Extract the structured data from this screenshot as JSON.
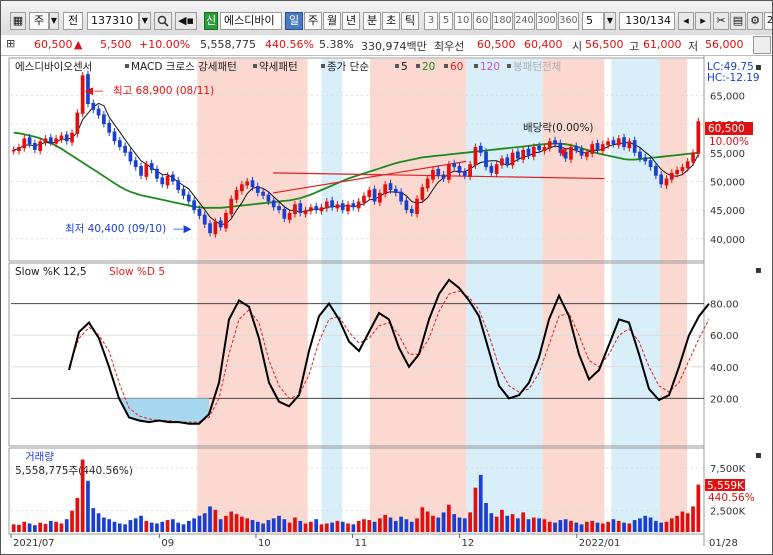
{
  "toolbar": {
    "code_type": "주",
    "period_type": "전",
    "stock_code": "137310",
    "new_badge": "신",
    "stock_name": "에스디바이",
    "period_buttons": [
      "일",
      "주",
      "월",
      "년",
      "분",
      "초",
      "틱"
    ],
    "minute_buttons": [
      "3",
      "5",
      "10",
      "60",
      "180",
      "240",
      "300",
      "360"
    ],
    "unit_value": "5",
    "count_display": "130",
    "count_total": "/134"
  },
  "quote": {
    "price": "60,500",
    "change": "5,500",
    "change_pct": "+10.00%",
    "volume": "5,558,775",
    "volume_ratio": "440.56%",
    "turnover": "5.38%",
    "amount": "330,974백만",
    "priority_label": "최우선",
    "ask": "60,500",
    "bid": "60,400",
    "open_label": "시",
    "open": "56,500",
    "high_label": "고",
    "high": "61,000",
    "low_label": "저",
    "low": "56,000"
  },
  "panes": {
    "price_title": "에스디바이오센서",
    "price_indicators": [
      {
        "label": "MACD 크로스 강세패턴",
        "color": "#222222"
      },
      {
        "label": "약세패턴",
        "color": "#222222"
      },
      {
        "label": "종가 단순",
        "color": "#222222"
      },
      {
        "label": "5",
        "color": "#111111"
      },
      {
        "label": "20",
        "color": "#1e8a1e"
      },
      {
        "label": "60",
        "color": "#e02020"
      },
      {
        "label": "120",
        "color": "#d04fd0"
      },
      {
        "label": "봉패턴전체",
        "color": "#b0b0b0"
      }
    ],
    "lc_label": "LC:49.75",
    "hc_label": "HC:-12.19",
    "high_marker": "최고 68,900 (08/11)",
    "low_marker": "최저 40,400 (09/10)",
    "dividend_marker": "배당락(0.00%)",
    "price_tag": "60,500",
    "pct_tag": "10.00%",
    "price_axis": [
      "65,000",
      "60,000",
      "55,000",
      "50,000",
      "45,000",
      "40,000"
    ],
    "stoch_title": "Slow %K 12,5",
    "stoch_title2": "Slow %D 5",
    "stoch_axis": [
      "80.00",
      "60.00",
      "40.00",
      "20.00"
    ],
    "volume_title": "거래량",
    "volume_value": "5,558,775주(440.56%)",
    "volume_axis": [
      "7,500K",
      "2,500K"
    ],
    "volume_tag": "5,559K",
    "volume_pct_tag": "440.56%",
    "date_axis": [
      "2021/07",
      "09",
      "10",
      "11",
      "12",
      "2022/01",
      "01/28"
    ]
  },
  "colors": {
    "up": "#e01010",
    "down": "#1a3fd0",
    "ma5": "#111111",
    "ma20": "#1e8a1e",
    "ma60": "#e02020",
    "ma120": "#d04fd0",
    "bull_band": "#fbd9d0",
    "bear_band": "#d8eef9"
  },
  "chart_data": {
    "type": "candlestick",
    "price_ylim": [
      37000,
      71000
    ],
    "candles_close": [
      55500,
      56000,
      57500,
      56500,
      55500,
      57000,
      57500,
      56800,
      57500,
      58000,
      57000,
      58500,
      62000,
      68500,
      63500,
      62500,
      61500,
      60000,
      58500,
      57000,
      56000,
      55000,
      53500,
      52500,
      51000,
      53000,
      52000,
      50500,
      49500,
      51000,
      50000,
      48500,
      47500,
      46500,
      45000,
      44000,
      42500,
      41000,
      43000,
      42000,
      44500,
      47000,
      48500,
      49500,
      50000,
      49000,
      48000,
      47500,
      46500,
      45500,
      45000,
      43500,
      44500,
      46000,
      44500,
      45000,
      45500,
      45000,
      45500,
      46500,
      45500,
      46000,
      45000,
      46000,
      45500,
      46500,
      47500,
      48500,
      46500,
      48000,
      49500,
      48500,
      48000,
      46500,
      45000,
      44500,
      47000,
      49000,
      50500,
      52000,
      51000,
      50500,
      53000,
      52500,
      51500,
      51000,
      53000,
      56000,
      55000,
      52500,
      51500,
      53000,
      54000,
      53000,
      55000,
      54000,
      55500,
      54500,
      56000,
      55500,
      56000,
      57000,
      56500,
      55000,
      54000,
      56000,
      55500,
      54500,
      55000,
      56500,
      55500,
      56500,
      57000,
      56500,
      57500,
      56000,
      57000,
      55000,
      54000,
      53500,
      52500,
      51000,
      49500,
      50500,
      51500,
      52000,
      52500,
      53500,
      55000,
      60500
    ],
    "candles_up": [
      true,
      true,
      true,
      false,
      false,
      true,
      true,
      false,
      true,
      true,
      false,
      true,
      true,
      true,
      false,
      false,
      false,
      false,
      false,
      false,
      false,
      false,
      false,
      false,
      false,
      true,
      false,
      false,
      false,
      true,
      false,
      false,
      false,
      false,
      false,
      false,
      false,
      false,
      true,
      false,
      true,
      true,
      true,
      true,
      true,
      false,
      false,
      false,
      false,
      false,
      false,
      false,
      true,
      true,
      false,
      true,
      true,
      false,
      true,
      true,
      false,
      true,
      false,
      true,
      false,
      true,
      true,
      true,
      false,
      true,
      true,
      false,
      false,
      false,
      false,
      false,
      true,
      true,
      true,
      true,
      false,
      false,
      true,
      false,
      false,
      false,
      true,
      true,
      false,
      false,
      false,
      true,
      true,
      false,
      true,
      false,
      true,
      false,
      true,
      false,
      true,
      true,
      false,
      false,
      false,
      true,
      false,
      false,
      true,
      true,
      false,
      true,
      true,
      false,
      true,
      false,
      true,
      false,
      false,
      false,
      false,
      false,
      false,
      true,
      true,
      true,
      true,
      true,
      true,
      true
    ],
    "ma20": [
      58500,
      58400,
      58200,
      58000,
      57800,
      57500,
      57100,
      56700,
      56200,
      55700,
      55100,
      54500,
      53900,
      53300,
      52700,
      52100,
      51500,
      50900,
      50300,
      49700,
      49100,
      48600,
      48200,
      47900,
      47600,
      47400,
      47200,
      47000,
      46800,
      46600,
      46400,
      46200,
      46000,
      45800,
      45600,
      45500,
      45400,
      45400,
      45400,
      45400,
      45500,
      45600,
      45700,
      45800,
      45900,
      46000,
      46100,
      46200,
      46300,
      46400,
      46500,
      46600,
      46700,
      46900,
      47100,
      47400,
      47700,
      48100,
      48500,
      48900,
      49300,
      49700,
      50100,
      50500,
      50800,
      51100,
      51400,
      51700,
      52000,
      52300,
      52600,
      52900,
      53200,
      53400,
      53600,
      53800,
      54000,
      54200,
      54300,
      54400,
      54500,
      54600,
      54700,
      54800,
      54900,
      55000,
      55100,
      55200,
      55300,
      55400,
      55500,
      55600,
      55700,
      55800,
      55900,
      56000,
      56100,
      56200,
      56300,
      56400,
      56500,
      56600,
      56600,
      56600,
      56500,
      56300,
      56100,
      55800,
      55500,
      55200,
      54900,
      54700,
      54500,
      54300,
      54100,
      53900,
      53800,
      53800,
      53900,
      54000,
      54100,
      54200,
      54300,
      54400,
      54500,
      54600,
      54700,
      54800,
      54900,
      55000
    ],
    "ma60_segment_x": [
      0.38,
      0.86
    ],
    "ma60_segment_y": [
      51500,
      50500
    ],
    "stoch_k": [
      38,
      62,
      68,
      58,
      40,
      20,
      8,
      6,
      5,
      6,
      5,
      5,
      4,
      4,
      10,
      30,
      70,
      82,
      78,
      58,
      30,
      18,
      15,
      22,
      50,
      72,
      80,
      70,
      56,
      50,
      62,
      74,
      70,
      52,
      40,
      48,
      70,
      86,
      95,
      90,
      82,
      72,
      50,
      28,
      20,
      22,
      30,
      46,
      70,
      85,
      72,
      48,
      32,
      38,
      54,
      70,
      68,
      48,
      26,
      19,
      22,
      40,
      60,
      72,
      80
    ],
    "stoch_d": [
      40,
      58,
      65,
      60,
      50,
      30,
      14,
      9,
      7,
      6,
      6,
      5,
      5,
      5,
      8,
      20,
      48,
      70,
      76,
      68,
      44,
      28,
      20,
      22,
      35,
      56,
      70,
      72,
      62,
      55,
      58,
      66,
      68,
      60,
      48,
      48,
      58,
      75,
      86,
      88,
      84,
      76,
      60,
      40,
      28,
      24,
      26,
      36,
      54,
      72,
      74,
      60,
      44,
      40,
      48,
      60,
      64,
      56,
      40,
      28,
      24,
      30,
      44,
      58,
      70
    ],
    "volume_k": [
      900,
      850,
      1200,
      1000,
      800,
      1100,
      950,
      1300,
      1200,
      1000,
      1500,
      2500,
      4000,
      8500,
      6000,
      2800,
      2200,
      1700,
      1500,
      1200,
      1000,
      900,
      1400,
      1600,
      1900,
      1300,
      1100,
      1000,
      1200,
      1400,
      1500,
      1100,
      900,
      1300,
      1600,
      1900,
      2200,
      3000,
      2600,
      1500,
      1900,
      2400,
      2100,
      1800,
      1600,
      1400,
      1200,
      1000,
      1400,
      1600,
      1900,
      1500,
      1100,
      1700,
      1300,
      1000,
      1200,
      1500,
      900,
      1000,
      1100,
      1300,
      1200,
      1000,
      900,
      1300,
      1500,
      1400,
      1200,
      1600,
      2000,
      1700,
      1300,
      1800,
      1500,
      1200,
      1600,
      2900,
      2400,
      1900,
      1700,
      2300,
      3200,
      2100,
      1700,
      1600,
      2300,
      5200,
      6700,
      3400,
      2200,
      1800,
      2600,
      1900,
      2100,
      1600,
      2300,
      1500,
      1700,
      1600,
      1500,
      1200,
      1100,
      1400,
      1500,
      1300,
      1100,
      900,
      1200,
      1300,
      1100,
      1000,
      1200,
      1500,
      1300,
      1100,
      1000,
      1400,
      1600,
      1900,
      1700,
      1300,
      1100,
      1200,
      1600,
      1900,
      2400,
      2200,
      3000,
      5559
    ],
    "bull_bands": [
      [
        0.27,
        0.43
      ],
      [
        0.52,
        0.66
      ],
      [
        0.77,
        0.86
      ],
      [
        0.94,
        0.98
      ]
    ],
    "bear_bands": [
      [
        0.45,
        0.48
      ],
      [
        0.66,
        0.77
      ],
      [
        0.87,
        0.94
      ]
    ]
  }
}
